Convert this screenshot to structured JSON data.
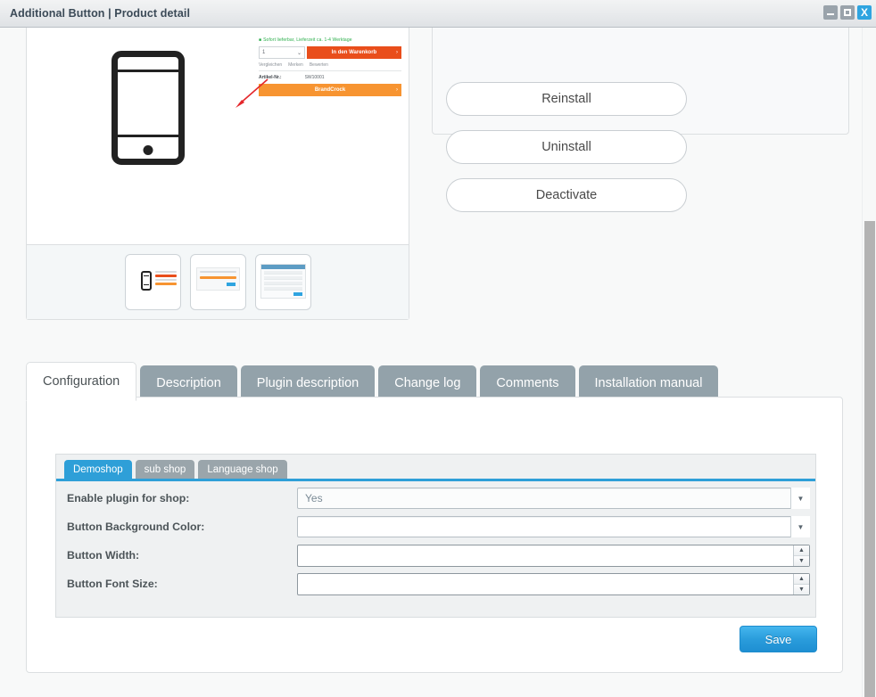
{
  "window": {
    "title": "Additional Button | Product detail",
    "controls": {
      "minimize": "minimize-icon",
      "maximize": "maximize-icon",
      "close": "X"
    }
  },
  "preview": {
    "shop_mock": {
      "availability": "Sofort lieferbar, Lieferzeit ca. 1-4 Werktage",
      "quantity_value": "1",
      "add_to_cart": "In den Warenkorb",
      "links": [
        "Vergleichen",
        "Merken",
        "Bewerten"
      ],
      "article_label": "Artikel-Nr.:",
      "article_number": "SW10001",
      "custom_button": "BrandCrock",
      "chevron": "›"
    },
    "thumbnails": [
      {
        "name": "thumbnail-product-detail"
      },
      {
        "name": "thumbnail-configuration"
      },
      {
        "name": "thumbnail-backend"
      }
    ]
  },
  "actions": {
    "reinstall": "Reinstall",
    "uninstall": "Uninstall",
    "deactivate": "Deactivate"
  },
  "tabs": [
    {
      "label": "Configuration",
      "active": true
    },
    {
      "label": "Description",
      "active": false
    },
    {
      "label": "Plugin description",
      "active": false
    },
    {
      "label": "Change log",
      "active": false
    },
    {
      "label": "Comments",
      "active": false
    },
    {
      "label": "Installation manual",
      "active": false
    }
  ],
  "subtabs": [
    {
      "label": "Demoshop",
      "active": true
    },
    {
      "label": "sub shop",
      "active": false
    },
    {
      "label": "Language shop",
      "active": false
    }
  ],
  "form": {
    "fields": [
      {
        "label": "Enable plugin for shop:",
        "type": "select",
        "value": "Yes"
      },
      {
        "label": "Button Background Color:",
        "type": "select",
        "value": ""
      },
      {
        "label": "Button Width:",
        "type": "number",
        "value": ""
      },
      {
        "label": "Button Font Size:",
        "type": "number",
        "value": ""
      }
    ],
    "save_label": "Save"
  },
  "icons": {
    "chevron_down": "▼",
    "spinner_up": "▲",
    "spinner_down": "▼"
  },
  "colors": {
    "accent_blue": "#2e9fd8",
    "tab_inactive": "#93a2aa",
    "cart_red": "#e94e1b",
    "brand_orange": "#f79431",
    "panel_bg": "#eff1f2"
  }
}
